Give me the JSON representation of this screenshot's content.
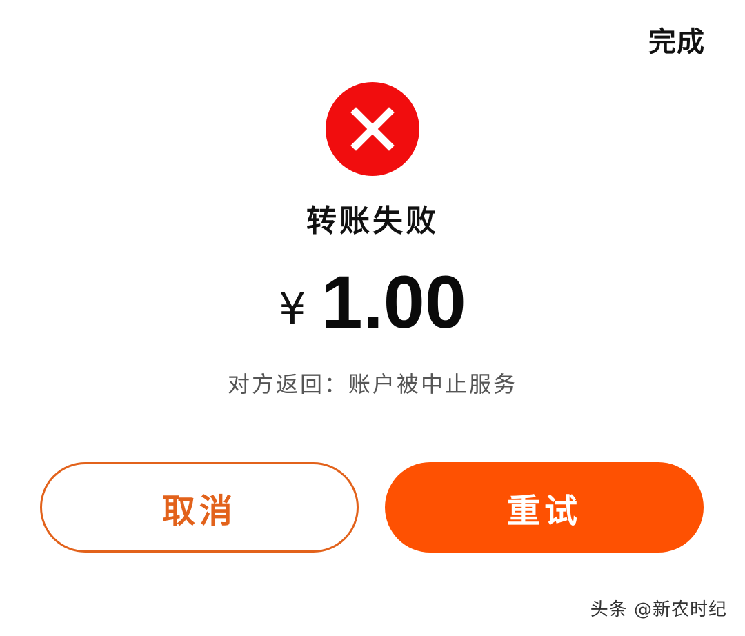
{
  "header": {
    "done_label": "完成"
  },
  "status": {
    "icon": "close-icon",
    "icon_color": "#f10d0e",
    "title": "转账失败"
  },
  "amount": {
    "currency_symbol": "¥",
    "value": "1.00"
  },
  "reason": "对方返回：账户被中止服务",
  "actions": {
    "cancel_label": "取消",
    "retry_label": "重试",
    "accent_color": "#fe5102",
    "cancel_text_color": "#e2621b"
  },
  "watermark": "头条 @新农时纪"
}
